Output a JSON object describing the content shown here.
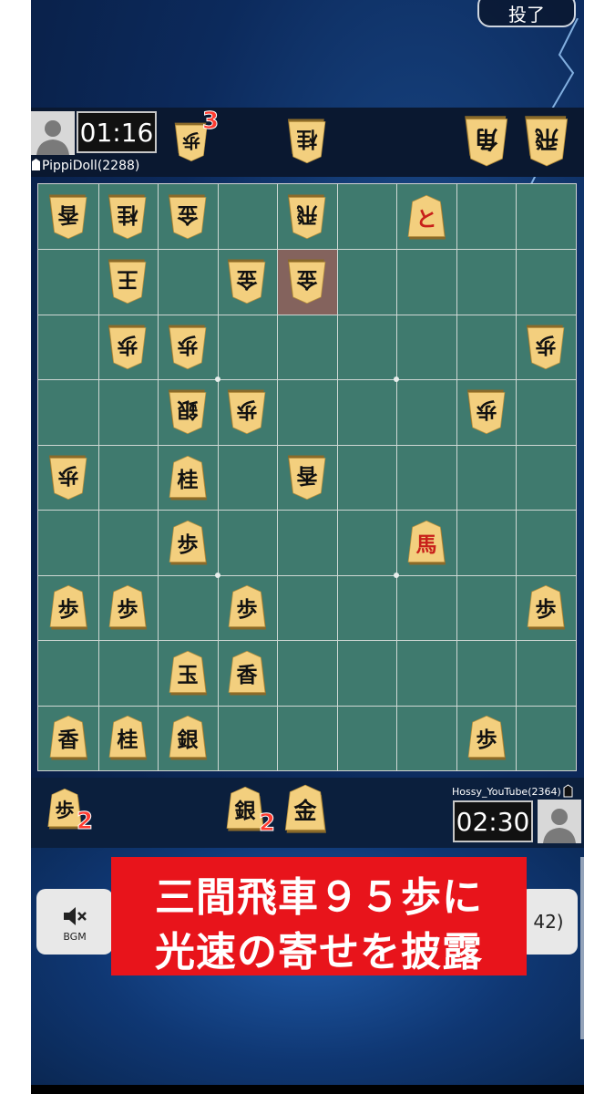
{
  "header": {
    "resign_label": "投了"
  },
  "opponent": {
    "name": "PippiDoll(2288)",
    "time": "01:16"
  },
  "player": {
    "name": "Hossy_YouTube(2364)",
    "time": "02:30"
  },
  "opponent_hand": [
    {
      "kanji": "歩",
      "count": "3"
    },
    {
      "kanji": "桂",
      "count": ""
    },
    {
      "kanji": "角",
      "count": ""
    },
    {
      "kanji": "飛",
      "count": ""
    }
  ],
  "player_hand": [
    {
      "kanji": "歩",
      "count": "2"
    },
    {
      "kanji": "銀",
      "count": "2"
    },
    {
      "kanji": "金",
      "count": ""
    }
  ],
  "board": {
    "last_move": {
      "row": 2,
      "col": 5
    },
    "pieces": [
      {
        "row": 1,
        "col": 1,
        "kanji": "香",
        "side": "gote",
        "promoted": false
      },
      {
        "row": 1,
        "col": 2,
        "kanji": "桂",
        "side": "gote",
        "promoted": false
      },
      {
        "row": 1,
        "col": 3,
        "kanji": "金",
        "side": "gote",
        "promoted": false
      },
      {
        "row": 1,
        "col": 5,
        "kanji": "飛",
        "side": "gote",
        "promoted": false
      },
      {
        "row": 1,
        "col": 7,
        "kanji": "と",
        "side": "sente",
        "promoted": true
      },
      {
        "row": 2,
        "col": 2,
        "kanji": "王",
        "side": "gote",
        "promoted": false
      },
      {
        "row": 2,
        "col": 4,
        "kanji": "金",
        "side": "gote",
        "promoted": false
      },
      {
        "row": 2,
        "col": 5,
        "kanji": "金",
        "side": "gote",
        "promoted": false
      },
      {
        "row": 3,
        "col": 2,
        "kanji": "歩",
        "side": "gote",
        "promoted": false
      },
      {
        "row": 3,
        "col": 3,
        "kanji": "歩",
        "side": "gote",
        "promoted": false
      },
      {
        "row": 3,
        "col": 9,
        "kanji": "歩",
        "side": "gote",
        "promoted": false
      },
      {
        "row": 4,
        "col": 3,
        "kanji": "銀",
        "side": "gote",
        "promoted": false
      },
      {
        "row": 4,
        "col": 4,
        "kanji": "歩",
        "side": "gote",
        "promoted": false
      },
      {
        "row": 4,
        "col": 8,
        "kanji": "歩",
        "side": "gote",
        "promoted": false
      },
      {
        "row": 5,
        "col": 1,
        "kanji": "歩",
        "side": "gote",
        "promoted": false
      },
      {
        "row": 5,
        "col": 3,
        "kanji": "桂",
        "side": "sente",
        "promoted": false
      },
      {
        "row": 5,
        "col": 5,
        "kanji": "香",
        "side": "gote",
        "promoted": false
      },
      {
        "row": 6,
        "col": 3,
        "kanji": "歩",
        "side": "sente",
        "promoted": false
      },
      {
        "row": 6,
        "col": 7,
        "kanji": "馬",
        "side": "sente",
        "promoted": true
      },
      {
        "row": 7,
        "col": 1,
        "kanji": "歩",
        "side": "sente",
        "promoted": false
      },
      {
        "row": 7,
        "col": 2,
        "kanji": "歩",
        "side": "sente",
        "promoted": false
      },
      {
        "row": 7,
        "col": 4,
        "kanji": "歩",
        "side": "sente",
        "promoted": false
      },
      {
        "row": 7,
        "col": 9,
        "kanji": "歩",
        "side": "sente",
        "promoted": false
      },
      {
        "row": 8,
        "col": 3,
        "kanji": "玉",
        "side": "sente",
        "promoted": false
      },
      {
        "row": 8,
        "col": 4,
        "kanji": "香",
        "side": "sente",
        "promoted": false
      },
      {
        "row": 9,
        "col": 1,
        "kanji": "香",
        "side": "sente",
        "promoted": false
      },
      {
        "row": 9,
        "col": 2,
        "kanji": "桂",
        "side": "sente",
        "promoted": false
      },
      {
        "row": 9,
        "col": 3,
        "kanji": "銀",
        "side": "sente",
        "promoted": false
      },
      {
        "row": 9,
        "col": 8,
        "kanji": "歩",
        "side": "sente",
        "promoted": false
      }
    ]
  },
  "controls": {
    "bgm_label": "BGM",
    "right_label": "42)"
  },
  "caption": {
    "line1": "三間飛車９５歩に",
    "line2": "光速の寄せを披露"
  }
}
